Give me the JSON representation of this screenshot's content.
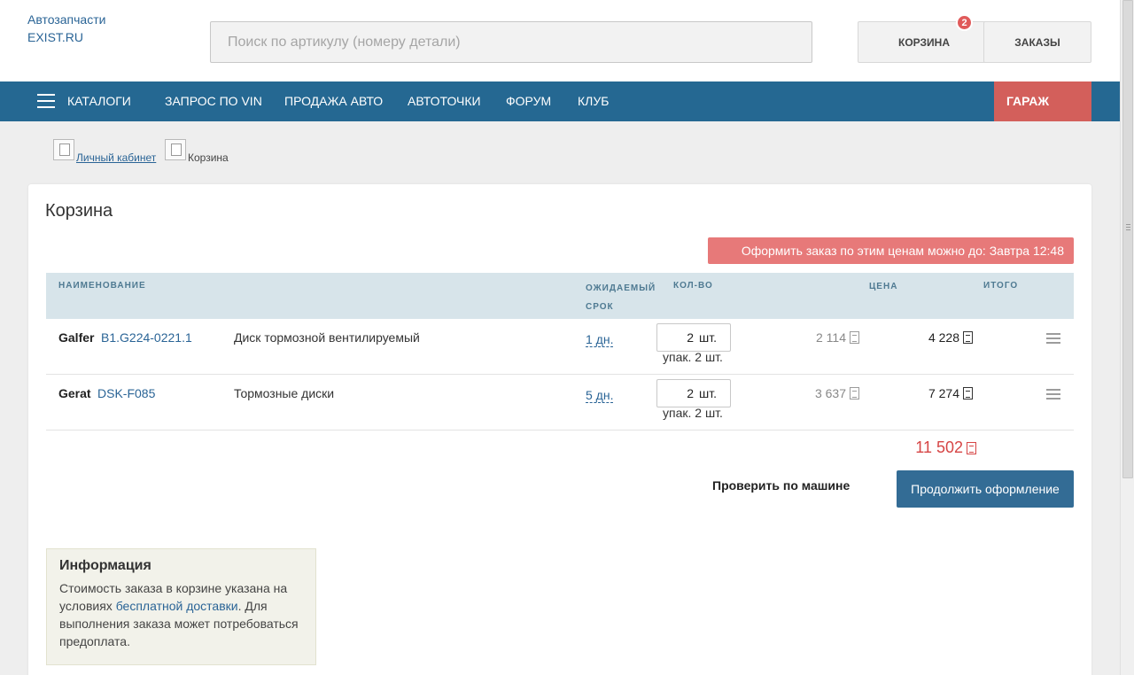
{
  "header": {
    "logo_line1": "Автозапчасти",
    "logo_line2": "EXIST.RU",
    "search_placeholder": "Поиск по артикулу (номеру детали)",
    "cart_label": "КОРЗИНА",
    "cart_badge": "2",
    "orders_label": "ЗАКАЗЫ"
  },
  "nav": {
    "items": [
      "КАТАЛОГИ",
      "ЗАПРОС ПО VIN",
      "ПРОДАЖА АВТО",
      "АВТОТОЧКИ",
      "ФОРУМ",
      "КЛУБ"
    ],
    "garage": "ГАРАЖ"
  },
  "breadcrumb": {
    "link": "Личный кабинет",
    "current": "Корзина"
  },
  "cart": {
    "title": "Корзина",
    "deadline": "Оформить заказ по этим ценам можно до: Завтра 12:48",
    "columns": {
      "name": "НАИМЕНОВАНИЕ",
      "term_line1": "ОЖИДАЕМЫЙ",
      "term_line2": "СРОК",
      "qty": "КОЛ-ВО",
      "price": "ЦЕНА",
      "total": "ИТОГО"
    },
    "rows": [
      {
        "brand": "Galfer",
        "article": "B1.G224-0221.1",
        "description": "Диск тормозной вентилируемый",
        "term": "1 дн.",
        "qty": "2",
        "unit": "шт.",
        "pack": "упак. 2 шт.",
        "price": "2 114",
        "total": "4 228"
      },
      {
        "brand": "Gerat",
        "article": "DSK-F085",
        "description": "Тормозные диски",
        "term": "5 дн.",
        "qty": "2",
        "unit": "шт.",
        "pack": "упак. 2 шт.",
        "price": "3 637",
        "total": "7 274"
      }
    ],
    "grand_total": "11 502",
    "check_button": "Проверить по машине",
    "continue_button": "Продолжить оформление"
  },
  "info": {
    "title": "Информация",
    "text_before": "Стоимость заказа в корзине указана на условиях ",
    "link": "бесплатной доставки",
    "text_after": ". Для выполнения заказа может потребоваться предоплата."
  },
  "colors": {
    "nav_bg": "#256892",
    "garage_bg": "#d35f5b",
    "deadline_bg": "#e77979",
    "link": "#2a6496",
    "total_red": "#d64545",
    "continue_bg": "#336c95"
  }
}
